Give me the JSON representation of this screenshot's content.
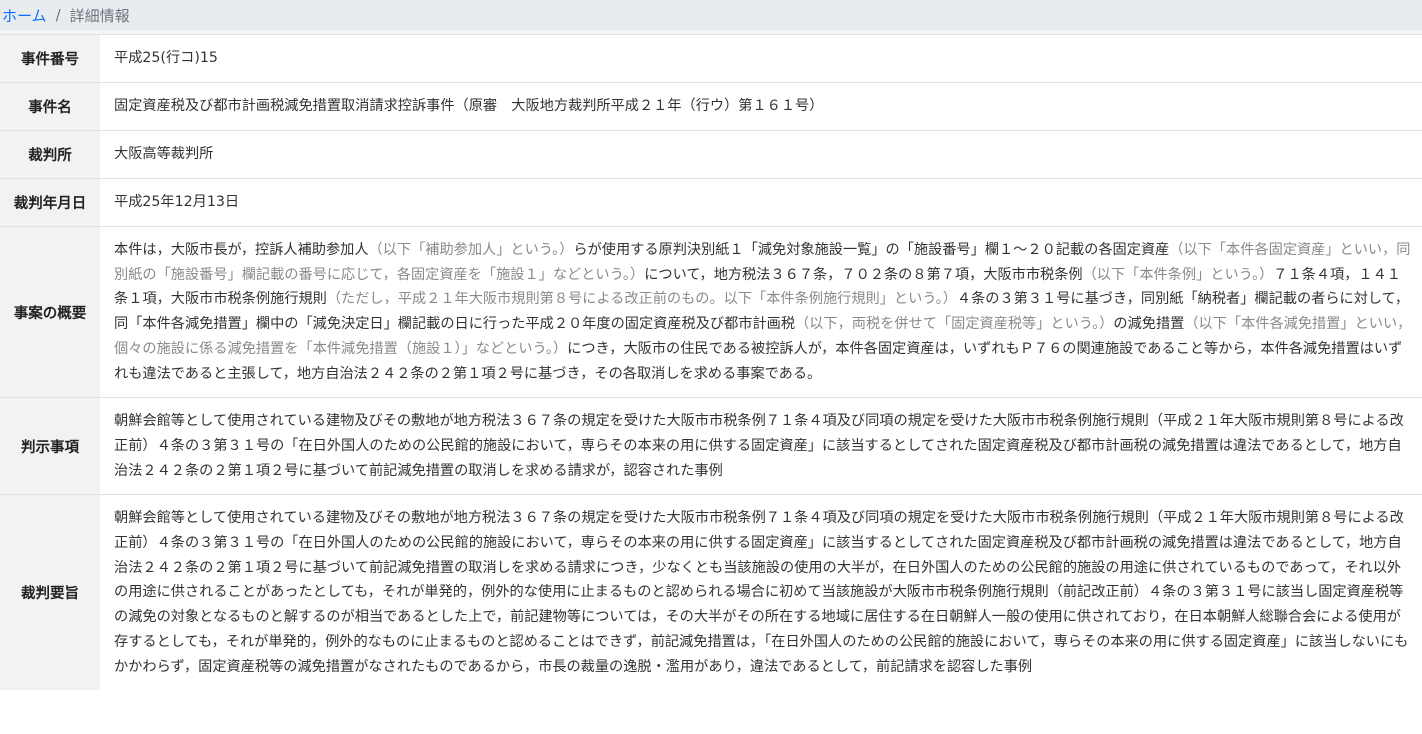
{
  "breadcrumb": {
    "home": "ホーム",
    "separator": "/",
    "current": "詳細情報"
  },
  "rows": {
    "case_number": {
      "label": "事件番号",
      "value": "平成25(行コ)15"
    },
    "case_name": {
      "label": "事件名",
      "value": "固定資産税及び都市計画税減免措置取消請求控訴事件（原審　大阪地方裁判所平成２１年（行ウ）第１６１号）"
    },
    "court": {
      "label": "裁判所",
      "value": "大阪高等裁判所"
    },
    "date": {
      "label": "裁判年月日",
      "value": "平成25年12月13日"
    },
    "summary": {
      "label": "事案の概要",
      "parts": [
        "本件は，大阪市長が，控訴人補助参加人",
        "（以下「補助参加人」という。）",
        "らが使用する原判決別紙１「減免対象施設一覧」の「施設番号」欄１～２０記載の各固定資産",
        "（以下「本件各固定資産」といい，同別紙の「施設番号」欄記載の番号に応じて，各固定資産を「施設１」などという。）",
        "について，地方税法３６７条，７０２条の８第７項，大阪市市税条例",
        "（以下「本件条例」という。）",
        "７１条４項，１４１条１項，大阪市市税条例施行規則",
        "（ただし，平成２１年大阪市規則第８号による改正前のもの。以下「本件条例施行規則」という。）",
        "４条の３第３１号に基づき，同別紙「納税者」欄記載の者らに対して，同「本件各減免措置」欄中の「減免決定日」欄記載の日に行った平成２０年度の固定資産税及び都市計画税",
        "（以下，両税を併せて「固定資産税等」という。）",
        "の減免措置",
        "（以下「本件各減免措置」といい，個々の施設に係る減免措置を「本件減免措置（施設１）」などという。）",
        "につき，大阪市の住民である被控訴人が，本件各固定資産は，いずれもＰ７６の関連施設であること等から，本件各減免措置はいずれも違法であると主張して，地方自治法２４２条の２第１項２号に基づき，その各取消しを求める事案である。"
      ]
    },
    "holding": {
      "label": "判示事項",
      "value": "朝鮮会館等として使用されている建物及びその敷地が地方税法３６７条の規定を受けた大阪市市税条例７１条４項及び同項の規定を受けた大阪市市税条例施行規則（平成２１年大阪市規則第８号による改正前）４条の３第３１号の「在日外国人のための公民館的施設において，専らその本来の用に供する固定資産」に該当するとしてされた固定資産税及び都市計画税の減免措置は違法であるとして，地方自治法２４２条の２第１項２号に基づいて前記減免措置の取消しを求める請求が，認容された事例"
    },
    "gist": {
      "label": "裁判要旨",
      "value": "朝鮮会館等として使用されている建物及びその敷地が地方税法３６７条の規定を受けた大阪市市税条例７１条４項及び同項の規定を受けた大阪市市税条例施行規則（平成２１年大阪市規則第８号による改正前）４条の３第３１号の「在日外国人のための公民館的施設において，専らその本来の用に供する固定資産」に該当するとしてされた固定資産税及び都市計画税の減免措置は違法であるとして，地方自治法２４２条の２第１項２号に基づいて前記減免措置の取消しを求める請求につき，少なくとも当該施設の使用の大半が，在日外国人のための公民館的施設の用途に供されているものであって，それ以外の用途に供されることがあったとしても，それが単発的，例外的な使用に止まるものと認められる場合に初めて当該施設が大阪市市税条例施行規則（前記改正前）４条の３第３１号に該当し固定資産税等の減免の対象となるものと解するのが相当であるとした上で，前記建物等については，その大半がその所在する地域に居住する在日朝鮮人一般の使用に供されており，在日本朝鮮人総聯合会による使用が存するとしても，それが単発的，例外的なものに止まるものと認めることはできず，前記減免措置は，「在日外国人のための公民館的施設において，専らその本来の用に供する固定資産」に該当しないにもかかわらず，固定資産税等の減免措置がなされたものであるから，市長の裁量の逸脱・濫用があり，違法であるとして，前記請求を認容した事例"
    }
  }
}
